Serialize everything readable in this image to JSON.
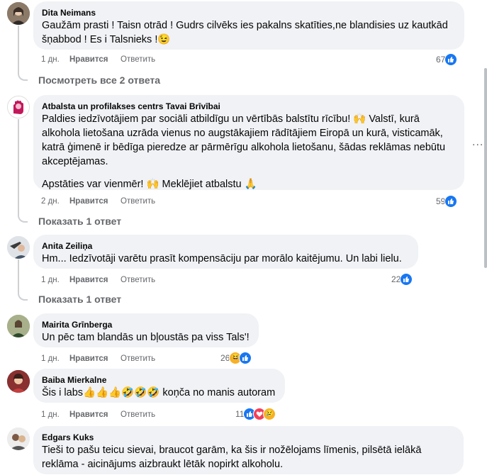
{
  "comments": [
    {
      "author": "Dita Neimans",
      "lines": [
        "Gaužām prasti ! Taisn otrād ! Gudrs cilvēks ies pakalns skatīties,ne blandisies uz kautkād",
        "šņabbod ! Es i Talsnieks !😉"
      ],
      "time": "1 дн.",
      "like": "Нравится",
      "reply": "Ответить",
      "count": "67",
      "reactions": [
        "like-icon"
      ],
      "replies_link": "Посмотреть все 2 ответа"
    },
    {
      "author": "Atbalsta un profilakses centrs Tavai Brīvībai",
      "lines": [
        "Paldies iedzīvotājiem par sociāli atbildīgu un vērtībās balstītu rīcību! 🙌 Valstī, kurā",
        "alkohola lietošana uzrāda vienus no augstākajiem rādītājiem Eiropā un kurā, visticamāk,",
        "katrā ģimenē ir bēdīga pieredze ar pārmērīgu alkohola lietošanu, šādas reklāmas nebūtu",
        "akceptējamas."
      ],
      "line2": "Apstāties var vienmēr! 🙌 Meklējiet atbalstu 🙏",
      "time": "2 дн.",
      "like": "Нравится",
      "reply": "Ответить",
      "count": "59",
      "reactions": [
        "like-icon"
      ],
      "replies_link": "Показать 1 ответ"
    },
    {
      "author": "Anita Zeiliņa",
      "lines": [
        "Hm... Iedzīvotāji varētu prasīt kompensāciju par morālo kaitējumu. Un labi lielu."
      ],
      "time": "1 дн.",
      "like": "Нравится",
      "reply": "Ответить",
      "count": "22",
      "reactions": [
        "like-icon"
      ],
      "replies_link": "Показать 1 ответ"
    },
    {
      "author": "Mairita Grīnberga",
      "lines": [
        "Un pēc tam blandās un bļoustās pa viss Tals'!"
      ],
      "time": "1 дн.",
      "like": "Нравится",
      "reply": "Ответить",
      "count": "26",
      "reactions": [
        "laugh-icon",
        "like-icon"
      ]
    },
    {
      "author": "Baiba Mierkalne",
      "lines": [
        "Šis i labs👍👍👍🤣🤣🤣 koņča no manis autoram"
      ],
      "time": "1 дн.",
      "like": "Нравится",
      "reply": "Ответить",
      "count": "11",
      "reactions": [
        "like-icon",
        "love-icon",
        "sad-icon"
      ]
    },
    {
      "author": "Edgars Kuks",
      "lines": [
        "Tieši to pašu teicu sievai, braucot garām, ka šis ir nožēlojams līmenis, pilsētā ielākā",
        "reklāma - aicinājums aizbraukt lētāk nopirkt alkoholu."
      ]
    }
  ],
  "options": "...",
  "colors": {
    "like": "#1877f2",
    "love": "#f33e58",
    "emoji": "#f7b125",
    "bubble": "#f0f2f5",
    "muted": "#65676b"
  }
}
